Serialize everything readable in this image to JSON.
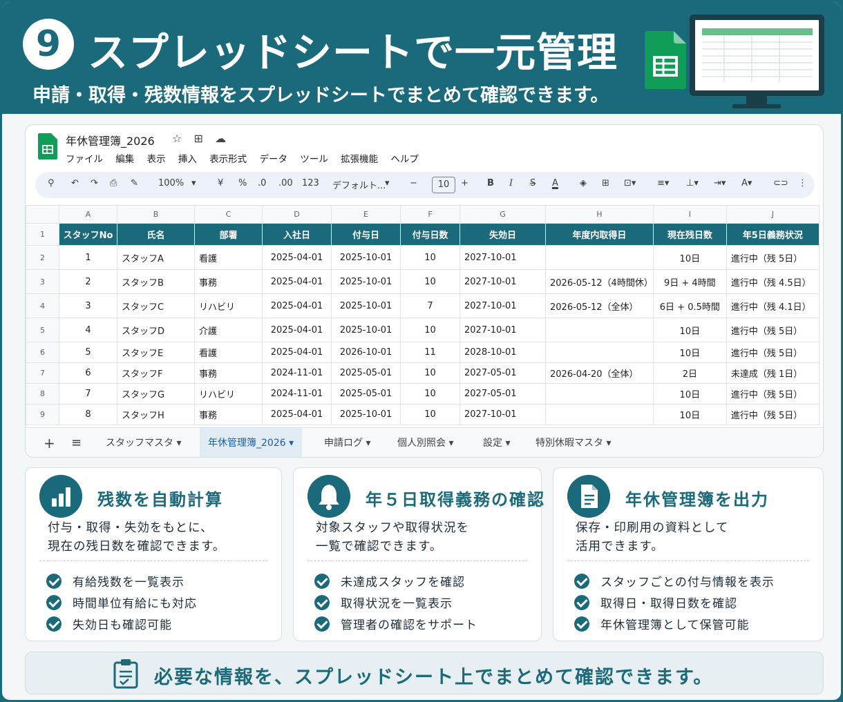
{
  "hero": {
    "number": "9",
    "title": "スプレッドシートで一元管理",
    "subtitle": "申請・取得・残数情報をスプレッドシートでまとめて確認できます。"
  },
  "doc": {
    "title": "年休管理簿_2026",
    "menu": [
      "ファイル",
      "編集",
      "表示",
      "挿入",
      "表示形式",
      "データ",
      "ツール",
      "拡張機能",
      "ヘルプ"
    ],
    "toolbar": {
      "zoom": "100%",
      "currency": "¥",
      "percent": "%",
      "dec_decrease": ".0",
      "dec_increase": ".00",
      "number_format": "123",
      "font": "デフォルト...",
      "font_size": "10",
      "bold": "B",
      "italic": "I",
      "strike": "S",
      "text_color": "A"
    }
  },
  "grid": {
    "col_letters": [
      "A",
      "B",
      "C",
      "D",
      "E",
      "F",
      "G",
      "H",
      "I",
      "J"
    ],
    "headers": [
      "スタッフNo",
      "氏名",
      "部署",
      "入社日",
      "付与日",
      "付与日数",
      "失効日",
      "年度内取得日",
      "現在残日数",
      "年5日義務状況"
    ],
    "rows": [
      [
        "1",
        "スタッフA",
        "看護",
        "2025-04-01",
        "2025-10-01",
        "10",
        "2027-10-01",
        "",
        "10日",
        "進行中（残 5日）"
      ],
      [
        "2",
        "スタッフB",
        "事務",
        "2025-04-01",
        "2025-10-01",
        "10",
        "2027-10-01",
        "2026-05-12（4時間休）",
        "9日 + 4時間",
        "進行中（残 4.5日）"
      ],
      [
        "3",
        "スタッフC",
        "リハビリ",
        "2025-04-01",
        "2025-10-01",
        "7",
        "2027-10-01",
        "2026-05-12（全体）",
        "6日 + 0.5時間",
        "進行中（残 4.1日）"
      ],
      [
        "4",
        "スタッフD",
        "介護",
        "2025-04-01",
        "2025-10-01",
        "10",
        "2027-10-01",
        "",
        "10日",
        "進行中（残 5日）"
      ],
      [
        "5",
        "スタッフE",
        "看護",
        "2025-04-01",
        "2026-10-01",
        "11",
        "2028-10-01",
        "",
        "10日",
        "進行中（残 5日）"
      ],
      [
        "6",
        "スタッフF",
        "事務",
        "2024-11-01",
        "2025-05-01",
        "10",
        "2027-05-01",
        "2026-04-20（全体）",
        "2日",
        "未達成（残 1日）"
      ],
      [
        "7",
        "スタッフG",
        "リハビリ",
        "2024-11-01",
        "2025-05-01",
        "10",
        "2027-05-01",
        "",
        "10日",
        "進行中（残 5日）"
      ],
      [
        "8",
        "スタッフH",
        "事務",
        "2025-04-01",
        "2025-10-01",
        "10",
        "2027-10-01",
        "",
        "10日",
        "進行中（残 5日）"
      ]
    ]
  },
  "tabs": [
    "スタッフマスタ",
    "年休管理簿_2026",
    "申請ログ",
    "個人別照会",
    "設定",
    "特別休暇マスタ"
  ],
  "cards": [
    {
      "icon": "bar-chart-icon",
      "title": "残数を自動計算",
      "desc1": "付与・取得・失効をもとに、",
      "desc2": "現在の残日数を確認できます。",
      "items": [
        "有給残数を一覧表示",
        "時間単位有給にも対応",
        "失効日も確認可能"
      ]
    },
    {
      "icon": "bell-icon",
      "title": "年５日取得義務の確認",
      "desc1": "対象スタッフや取得状況を",
      "desc2": "一覧で確認できます。",
      "items": [
        "未達成スタッフを確認",
        "取得状況を一覧表示",
        "管理者の確認をサポート"
      ]
    },
    {
      "icon": "document-icon",
      "title": "年休管理簿を出力",
      "desc1": "保存・印刷用の資料として",
      "desc2": "活用できます。",
      "items": [
        "スタッフごとの付与情報を表示",
        "取得日・取得日数を確認",
        "年休管理簿として保管可能"
      ]
    }
  ],
  "footer": {
    "text": "必要な情報を、スプレッドシート上でまとめて確認できます。"
  },
  "colors": {
    "brand": "#1a6a7c",
    "sheets_green": "#0f9d58",
    "active_tab": "#1a5fb4"
  }
}
